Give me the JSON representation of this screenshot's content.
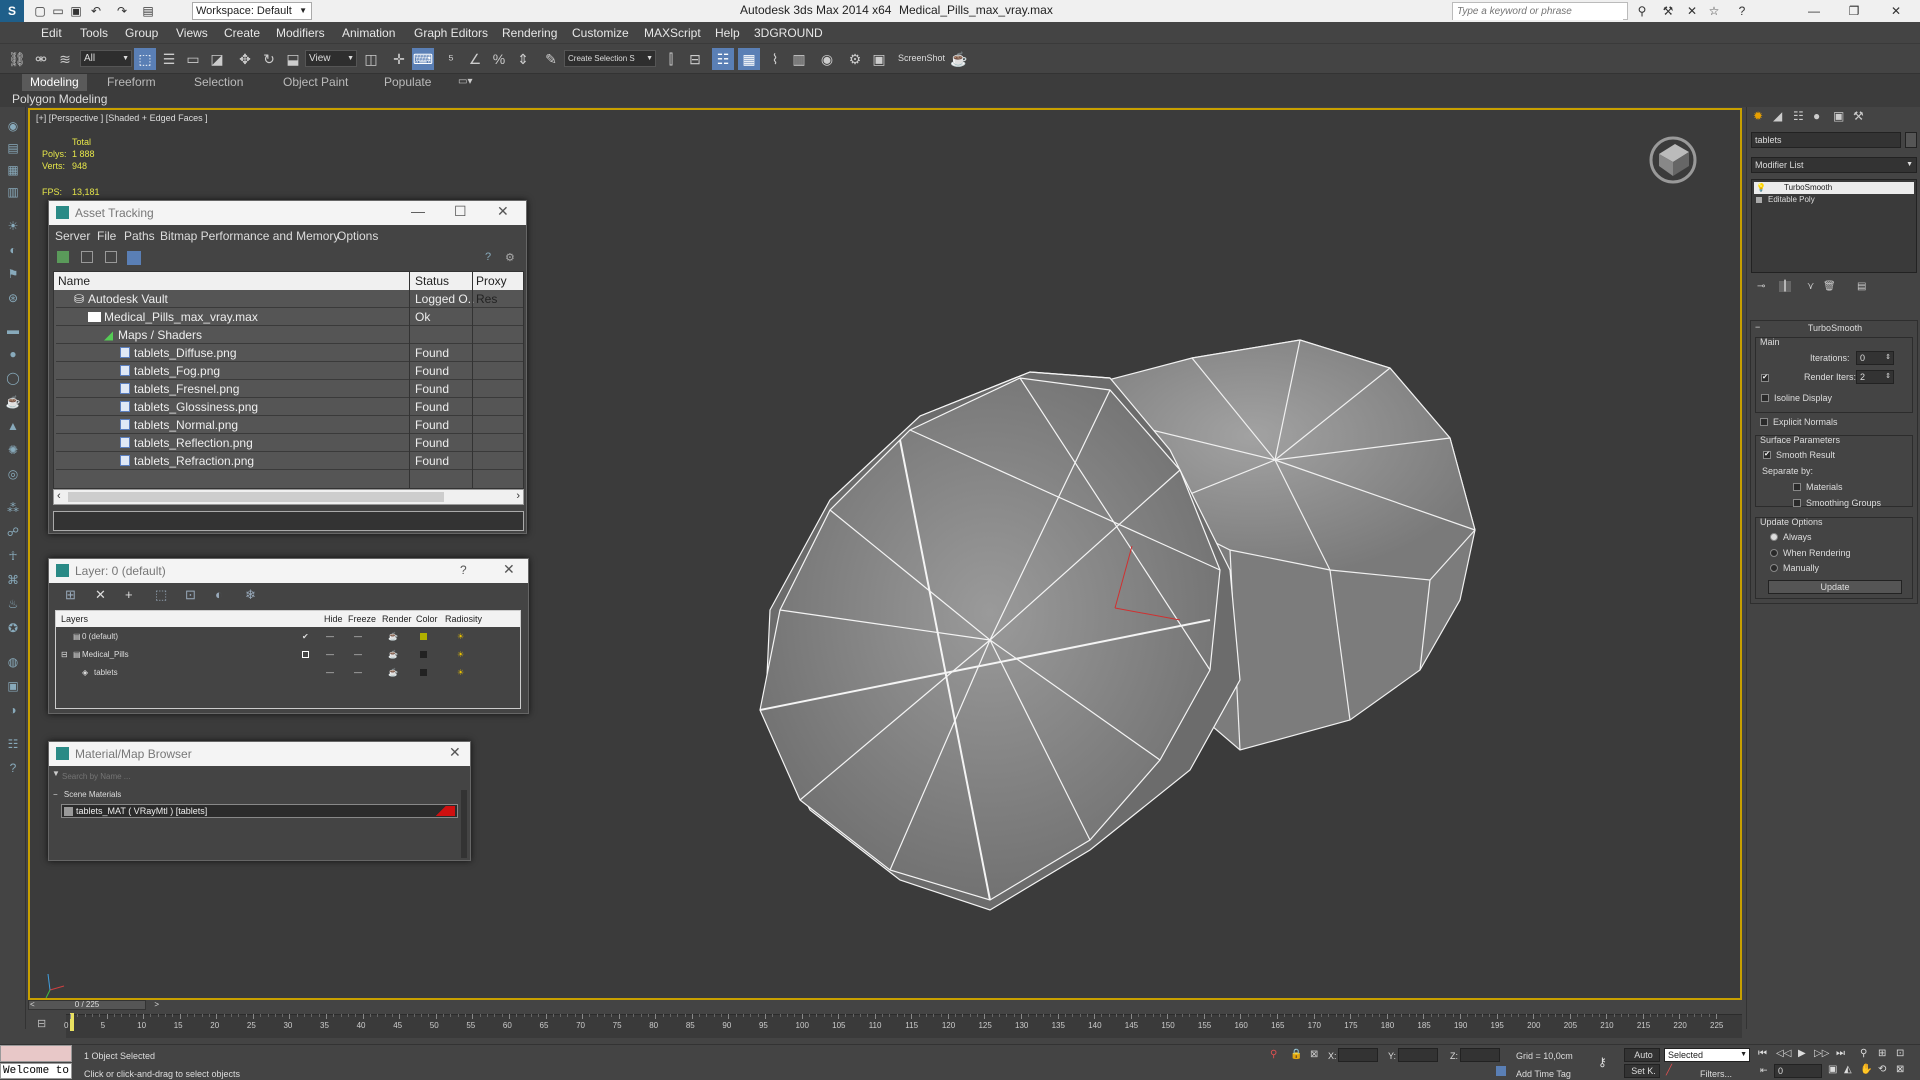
{
  "titlebar": {
    "workspace": "Workspace: Default",
    "app_title": "Autodesk 3ds Max  2014 x64",
    "file_name": "Medical_Pills_max_vray.max",
    "search_placeholder": "Type a keyword or phrase"
  },
  "menubar": [
    "Edit",
    "Tools",
    "Group",
    "Views",
    "Create",
    "Modifiers",
    "Animation",
    "Graph Editors",
    "Rendering",
    "Customize",
    "MAXScript",
    "Help",
    "3DGROUND"
  ],
  "toolbar": {
    "selection_filter": "All",
    "ref_coord": "View",
    "named_selection": "Create Selection S",
    "screenshot_label": "ScreenShot"
  },
  "ribbon": {
    "tabs": [
      "Modeling",
      "Freeform",
      "Selection",
      "Object Paint",
      "Populate"
    ],
    "sub_tab": "Polygon Modeling"
  },
  "viewport": {
    "label": "[+] [Perspective ] [Shaded + Edged Faces ]",
    "stats_total": "Total",
    "polys_label": "Polys:",
    "polys_value": "1 888",
    "verts_label": "Verts:",
    "verts_value": "948",
    "fps_label": "FPS:",
    "fps_value": "13,181"
  },
  "asset_tracking": {
    "title": "Asset Tracking",
    "menu": [
      "Server",
      "File",
      "Paths",
      "Bitmap Performance and Memory",
      "Options"
    ],
    "columns": [
      "Name",
      "Status",
      "Proxy Res"
    ],
    "rows": [
      {
        "name": "Autodesk Vault",
        "status": "Logged O..."
      },
      {
        "name": "Medical_Pills_max_vray.max",
        "status": "Ok"
      },
      {
        "name": "Maps / Shaders",
        "status": ""
      },
      {
        "name": "tablets_Diffuse.png",
        "status": "Found"
      },
      {
        "name": "tablets_Fog.png",
        "status": "Found"
      },
      {
        "name": "tablets_Fresnel.png",
        "status": "Found"
      },
      {
        "name": "tablets_Glossiness.png",
        "status": "Found"
      },
      {
        "name": "tablets_Normal.png",
        "status": "Found"
      },
      {
        "name": "tablets_Reflection.png",
        "status": "Found"
      },
      {
        "name": "tablets_Refraction.png",
        "status": "Found"
      }
    ]
  },
  "layer": {
    "title": "Layer: 0 (default)",
    "help": "?",
    "columns": [
      "Layers",
      "Hide",
      "Freeze",
      "Render",
      "Color",
      "Radiosity"
    ],
    "rows": [
      "0 (default)",
      "Medical_Pills",
      "tablets"
    ]
  },
  "material_browser": {
    "title": "Material/Map Browser",
    "search_placeholder": "Search by Name ...",
    "group": "Scene Materials",
    "item": "tablets_MAT ( VRayMtl ) [tablets]"
  },
  "command_panel": {
    "object_name": "tablets",
    "modifier_list": "Modifier List",
    "stack": [
      "TurboSmooth",
      "Editable Poly"
    ],
    "rollout_title": "TurboSmooth",
    "main_label": "Main",
    "iterations_label": "Iterations:",
    "iterations_value": "0",
    "render_iters_label": "Render Iters:",
    "render_iters_value": "2",
    "isoline_display": "Isoline Display",
    "explicit_normals": "Explicit Normals",
    "surface_parameters": "Surface Parameters",
    "smooth_result": "Smooth Result",
    "separate_by": "Separate by:",
    "materials": "Materials",
    "smoothing_groups": "Smoothing Groups",
    "update_options": "Update Options",
    "always": "Always",
    "when_rendering": "When Rendering",
    "manually": "Manually",
    "update_button": "Update"
  },
  "timeline": {
    "frame_counter": "0 / 225",
    "ticks": [
      "0",
      "5",
      "10",
      "15",
      "20",
      "25",
      "30",
      "35",
      "40",
      "45",
      "50",
      "55",
      "60",
      "65",
      "70",
      "75",
      "80",
      "85",
      "90",
      "95",
      "100",
      "105",
      "110",
      "115",
      "120",
      "125",
      "130",
      "135",
      "140",
      "145",
      "150",
      "155",
      "160",
      "165",
      "170",
      "175",
      "180",
      "185",
      "190",
      "195",
      "200",
      "205",
      "210",
      "215",
      "220",
      "225"
    ]
  },
  "statusbar": {
    "welcome": "Welcome to",
    "selected_count": "1 Object Selected",
    "prompt": "Click or click-and-drag to select objects",
    "x_label": "X:",
    "y_label": "Y:",
    "z_label": "Z:",
    "grid": "Grid = 10,0cm",
    "add_time_tag": "Add Time Tag",
    "auto": "Auto",
    "set_key": "Set K.",
    "selected_dropdown": "Selected",
    "filters": "Filters...",
    "current_frame": "0"
  }
}
